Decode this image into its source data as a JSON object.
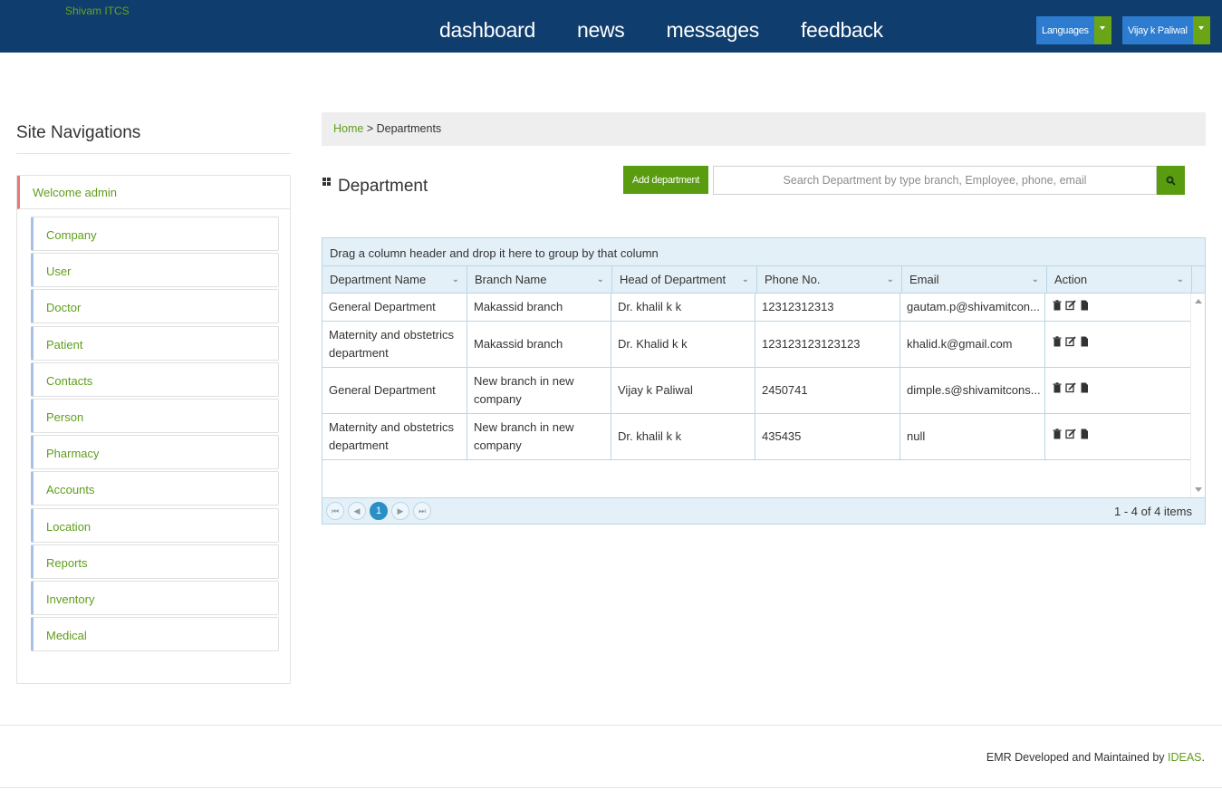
{
  "header": {
    "brand": "Shivam ITCS",
    "nav": [
      "dashboard",
      "news",
      "messages",
      "feedback"
    ],
    "languages_label": "Languages",
    "user_label": "Vijay k Paliwal"
  },
  "sidebar": {
    "title": "Site Navigations",
    "welcome": "Welcome admin",
    "items": [
      "Company",
      "User",
      "Doctor",
      "Patient",
      "Contacts",
      "Person",
      "Pharmacy",
      "Accounts",
      "Location",
      "Reports",
      "Inventory",
      "Medical"
    ]
  },
  "breadcrumb": {
    "home": "Home",
    "separator": ">",
    "current": "Departments"
  },
  "page": {
    "title": "Department",
    "add_button": "Add department",
    "search_placeholder": "Search Department by type branch, Employee, phone, email"
  },
  "grid": {
    "group_hint": "Drag a column header and drop it here to group by that column",
    "columns": [
      "Department Name",
      "Branch Name",
      "Head of Department",
      "Phone No.",
      "Email",
      "Action"
    ],
    "rows": [
      [
        "General Department",
        "Makassid branch",
        "Dr. khalil k k",
        "12312312313",
        "gautam.p@shivamitcon..."
      ],
      [
        "Maternity and obstetrics department",
        "Makassid branch",
        "Dr. Khalid k k",
        "123123123123123",
        "khalid.k@gmail.com"
      ],
      [
        "General Department",
        "New branch in new company",
        "Vijay k Paliwal",
        "2450741",
        "dimple.s@shivamitcons..."
      ],
      [
        "Maternity and obstetrics department",
        "New branch in new company",
        "Dr. khalil k k",
        "435435",
        "null"
      ]
    ],
    "current_page": "1",
    "pager_info": "1 - 4 of 4 items"
  },
  "footer": {
    "text": "EMR Developed and Maintained by ",
    "link": "IDEAS",
    "end": "."
  },
  "colors": {
    "topbar": "#0f3d6e",
    "accent_green": "#5a9c10",
    "link_green": "#5f9e1a",
    "grid_border": "#b9d6e6"
  }
}
